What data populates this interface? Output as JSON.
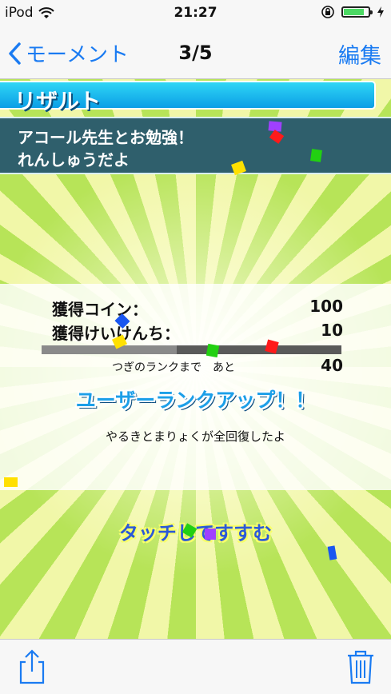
{
  "status_bar": {
    "carrier": "iPod",
    "time": "21:27",
    "wifi_icon": "wifi-icon",
    "rotation_lock_icon": "rotation-lock-icon",
    "battery_level": 0.85,
    "battery_color": "#4cd964"
  },
  "nav": {
    "back_label": "モーメント",
    "title": "3/5",
    "edit_label": "編集",
    "accent_color": "#1a7bf2"
  },
  "game": {
    "result_title": "リザルト",
    "lesson_lines": [
      "アコール先生とお勉強！",
      "れんしゅうだよ"
    ],
    "stats": [
      {
        "label": "獲得コイン：",
        "value": "100"
      },
      {
        "label": "獲得けいけんち：",
        "value": "10"
      }
    ],
    "progress": 0.45,
    "next_rank_label": "つぎのランクまで　あと",
    "next_rank_value": "40",
    "rankup_text": "ユーザーランクアップ！！",
    "recover_text": "やるきとまりょくが全回復したよ",
    "touch_prompt": "タッチしてすすむ"
  },
  "toolbar": {
    "share_icon": "share-icon",
    "trash_icon": "trash-icon"
  }
}
